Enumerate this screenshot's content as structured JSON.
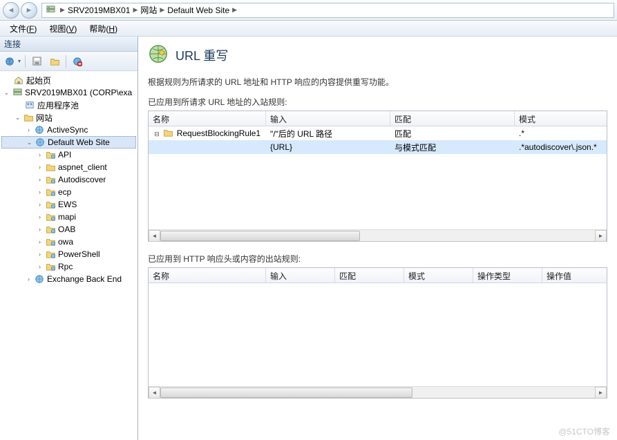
{
  "nav": {
    "crumbs": [
      "SRV2019MBX01",
      "网站",
      "Default Web Site"
    ]
  },
  "menu": {
    "file": "文件",
    "file_key": "F",
    "view": "视图",
    "view_key": "V",
    "help": "帮助",
    "help_key": "H"
  },
  "left": {
    "title": "连接",
    "tree": {
      "start": "起始页",
      "server": "SRV2019MBX01 (CORP\\exa",
      "appPools": "应用程序池",
      "sites": "网站",
      "items": [
        "ActiveSync",
        "Default Web Site",
        "API",
        "aspnet_client",
        "Autodiscover",
        "ecp",
        "EWS",
        "mapi",
        "OAB",
        "owa",
        "PowerShell",
        "Rpc"
      ],
      "exchange": "Exchange Back End"
    }
  },
  "page": {
    "title": "URL 重写",
    "desc": "根据规则为所请求的 URL 地址和 HTTP 响应的内容提供重写功能。",
    "inbound_label": "已应用到所请求 URL 地址的入站规则:",
    "outbound_label": "已应用到 HTTP 响应头或内容的出站规则:",
    "inbound_cols": [
      "名称",
      "输入",
      "匹配",
      "模式"
    ],
    "outbound_cols": [
      "名称",
      "输入",
      "匹配",
      "模式",
      "操作类型",
      "操作值"
    ],
    "rule": {
      "name": "RequestBlockingRule1",
      "input1": "\"/\"后的 URL 路径",
      "match1": "匹配",
      "pattern1": ".*",
      "input2": "{URL}",
      "match2": "与模式匹配",
      "pattern2": ".*autodiscover\\.json.*"
    }
  },
  "watermark": "@51CTO博客"
}
